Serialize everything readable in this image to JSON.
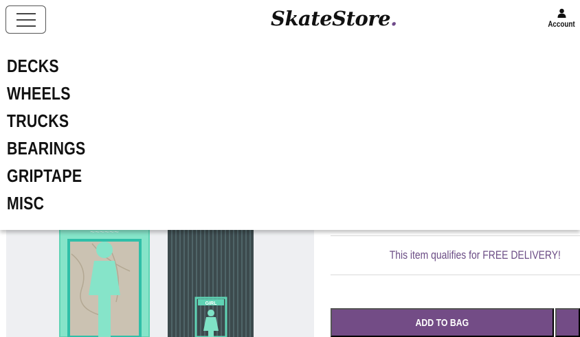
{
  "header": {
    "logo_text": "SkateStore",
    "logo_dot": ".",
    "account_label": "Account"
  },
  "nav": {
    "items": [
      {
        "label": "DECKS"
      },
      {
        "label": "WHEELS"
      },
      {
        "label": "TRUCKS"
      },
      {
        "label": "BEARINGS"
      },
      {
        "label": "GRIPTAPE"
      },
      {
        "label": "MISC"
      }
    ]
  },
  "product": {
    "deck_brand_label": "GIRL",
    "delivery_text": "This item qualifies for FREE DELIVERY!",
    "add_to_bag_label": "ADD TO BAG"
  },
  "colors": {
    "accent": "#734c86",
    "delivery_text": "#6b4c85",
    "deck_mint": "#7fe3c6"
  },
  "icons": {
    "menu": "hamburger-icon",
    "account": "user-icon"
  }
}
